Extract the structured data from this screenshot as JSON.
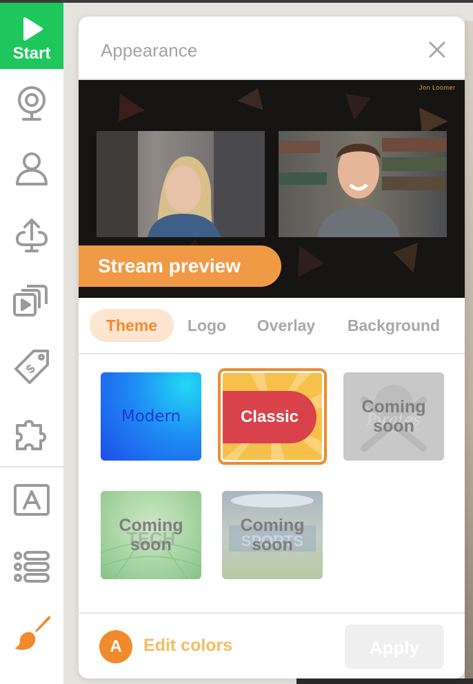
{
  "sidebar": {
    "start_label": "Start",
    "items": [
      {
        "icon": "webcam-icon"
      },
      {
        "icon": "user-icon"
      },
      {
        "icon": "upload-icon"
      },
      {
        "icon": "media-library-icon"
      },
      {
        "icon": "price-tag-icon"
      },
      {
        "icon": "puzzle-icon"
      },
      {
        "icon": "text-banner-icon"
      },
      {
        "icon": "list-icon"
      },
      {
        "icon": "brush-icon"
      }
    ],
    "accent": "#1dc75b",
    "active_color": "#f08a2c"
  },
  "panel": {
    "title": "Appearance",
    "preview": {
      "badge": "Stream preview",
      "brand_text": "Jon Loomer"
    },
    "tabs": [
      {
        "label": "Theme",
        "active": true
      },
      {
        "label": "Logo",
        "active": false
      },
      {
        "label": "Overlay",
        "active": false
      },
      {
        "label": "Background",
        "active": false
      }
    ],
    "themes": [
      {
        "label": "Modern",
        "selected": false
      },
      {
        "label": "Classic",
        "selected": true
      },
      {
        "label": "Coming soon",
        "background_text": "Pirates"
      },
      {
        "label": "Coming soon",
        "background_text": "TECH"
      },
      {
        "label": "Coming soon",
        "background_text": "SPORTS"
      }
    ],
    "footer": {
      "avatar_letter": "A",
      "edit_colors_label": "Edit colors",
      "apply_label": "Apply"
    }
  },
  "colors": {
    "orange": "#f08a2c",
    "orange_light": "#fde5cf",
    "red": "#d9424a",
    "yellow": "#f7c04a"
  }
}
